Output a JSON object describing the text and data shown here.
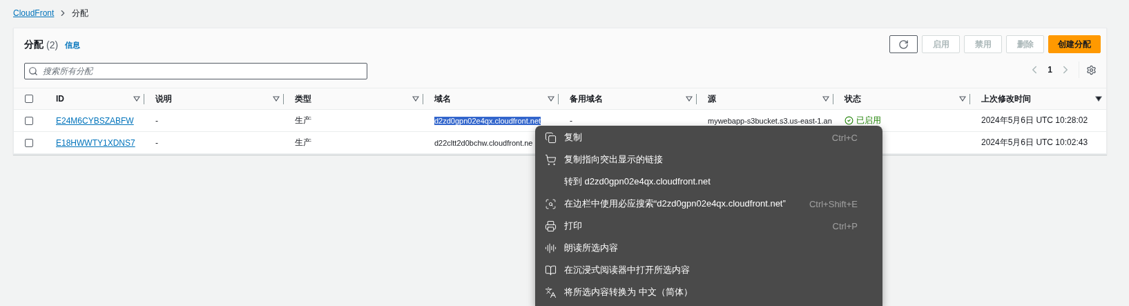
{
  "breadcrumb": [
    {
      "label": "CloudFront",
      "kind": "link"
    },
    {
      "label": "分配",
      "kind": "current"
    }
  ],
  "panel": {
    "title": "分配",
    "count": "(2)",
    "info": "信息",
    "search": {
      "placeholder": "搜索所有分配"
    },
    "buttons": [
      {
        "kind": "refresh",
        "disabled": false
      },
      {
        "kind": "text",
        "label": "启用",
        "disabled": true
      },
      {
        "kind": "text",
        "label": "禁用",
        "disabled": true
      },
      {
        "kind": "text",
        "label": "删除",
        "disabled": true
      },
      {
        "kind": "primary",
        "label": "创建分配",
        "disabled": false
      }
    ],
    "pagination": {
      "page": "1"
    }
  },
  "table": {
    "select_all": {
      "checked": false
    },
    "columns": [
      {
        "label": "ID",
        "sorted": false
      },
      {
        "label": "说明",
        "sorted": false
      },
      {
        "label": "类型",
        "sorted": false
      },
      {
        "label": "域名",
        "sorted": false
      },
      {
        "label": "备用域名",
        "sorted": false
      },
      {
        "label": "源",
        "sorted": false
      },
      {
        "label": "状态",
        "sorted": false
      },
      {
        "label": "上次修改时间",
        "sorted": true
      }
    ],
    "rows": [
      {
        "checked": false,
        "id": "E24M6CYBSZABFW",
        "description": "-",
        "type": "生产",
        "domain": "d2zd0gpn02e4qx.cloudfront.net",
        "domain_highlighted": true,
        "alt_domain": "-",
        "origin": "mywebapp-s3bucket.s3.us-east-1.an",
        "status": "已启用",
        "modified": "2024年5月6日 UTC 10:28:02"
      },
      {
        "checked": false,
        "id": "E18HWWTY1XDNS7",
        "description": "-",
        "type": "生产",
        "domain": "d22cltt2d0bchw.cloudfront.ne",
        "domain_highlighted": false,
        "modified": "2024年5月6日 UTC 10:02:43"
      }
    ]
  },
  "context_menu": {
    "items": [
      {
        "kind": "copy",
        "label": "复制",
        "shortcut": "Ctrl+C"
      },
      {
        "kind": "cart",
        "label": "复制指向突出显示的链接"
      },
      {
        "kind": "plain",
        "label": "转到 d2zd0gpn02e4qx.cloudfront.net"
      },
      {
        "kind": "sidebar",
        "label": "在边栏中使用必应搜索“d2zd0gpn02e4qx.cloudfront.net”",
        "shortcut": "Ctrl+Shift+E"
      },
      {
        "kind": "print",
        "label": "打印",
        "shortcut": "Ctrl+P"
      },
      {
        "kind": "aloud",
        "label": "朗读所选内容"
      },
      {
        "kind": "reader",
        "label": "在沉浸式阅读器中打开所选内容"
      },
      {
        "kind": "translate",
        "label": "将所选内容转换为 中文（简体）"
      }
    ]
  }
}
